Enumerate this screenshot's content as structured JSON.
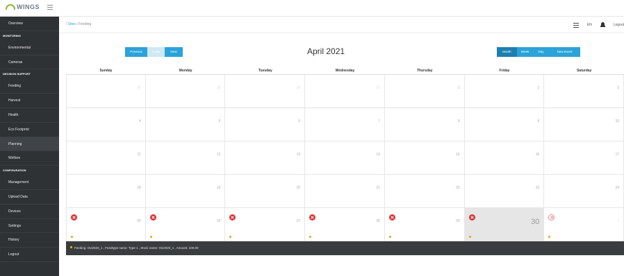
{
  "app": {
    "logo_text": "WINGS"
  },
  "sidebar": {
    "entries": [
      {
        "type": "item",
        "label": "Overview"
      },
      {
        "type": "section",
        "label": "MONITORING"
      },
      {
        "type": "item",
        "label": "Environmental"
      },
      {
        "type": "item",
        "label": "Cameras"
      },
      {
        "type": "section",
        "label": "DECISION SUPPORT"
      },
      {
        "type": "item",
        "label": "Feeding"
      },
      {
        "type": "item",
        "label": "Harvest"
      },
      {
        "type": "item",
        "label": "Health"
      },
      {
        "type": "item",
        "label": "Eco Footprint"
      },
      {
        "type": "item",
        "label": "Planning",
        "active": true
      },
      {
        "type": "item",
        "label": "Welfare"
      },
      {
        "type": "section",
        "label": "CONFIGURATION"
      },
      {
        "type": "item",
        "label": "Management"
      },
      {
        "type": "item",
        "label": "Upload Data"
      },
      {
        "type": "item",
        "label": "Devices"
      },
      {
        "type": "item",
        "label": "Settings"
      },
      {
        "type": "item",
        "label": "History"
      },
      {
        "type": "item",
        "label": "Logout"
      }
    ]
  },
  "header": {
    "breadcrumb_prefix": "/",
    "breadcrumb_link": "Sites",
    "breadcrumb_sep": "/",
    "breadcrumb_current": "Feeding",
    "language": "EN",
    "logout_label": "Logout"
  },
  "toolbar": {
    "prev_label": "Previous",
    "today_label": "Today",
    "next_label": "Next",
    "title": "April 2021",
    "month_label": "Month",
    "week_label": "Week",
    "day_label": "Day",
    "new_event_label": "New Event"
  },
  "calendar": {
    "weekdays": [
      "Sunday",
      "Monday",
      "Tuesday",
      "Wednesday",
      "Thursday",
      "Friday",
      "Saturday"
    ],
    "weeks": [
      [
        "28",
        "29",
        "30",
        "31",
        "1",
        "2",
        "3"
      ],
      [
        "4",
        "5",
        "6",
        "7",
        "8",
        "9",
        "10"
      ],
      [
        "11",
        "12",
        "13",
        "14",
        "15",
        "16",
        "17"
      ],
      [
        "18",
        "19",
        "20",
        "21",
        "22",
        "23",
        "24"
      ],
      [
        "25",
        "26",
        "27",
        "28",
        "29",
        "30",
        "1"
      ]
    ],
    "muted_cells": [
      "0-0",
      "0-1",
      "0-2",
      "0-3",
      "4-6"
    ],
    "today_cell": "4-5",
    "event_cells": [
      "4-0",
      "4-1",
      "4-2",
      "4-3",
      "4-4",
      "4-5",
      "4-6"
    ],
    "event_color": "#dd3333",
    "event_dot_color": "#e8a400"
  },
  "status": {
    "text": "Feeding: Ovi2020_1 , Feedtype name: Type 1 , Stock name: Ovi2020_1 , Amount: 100.00"
  }
}
